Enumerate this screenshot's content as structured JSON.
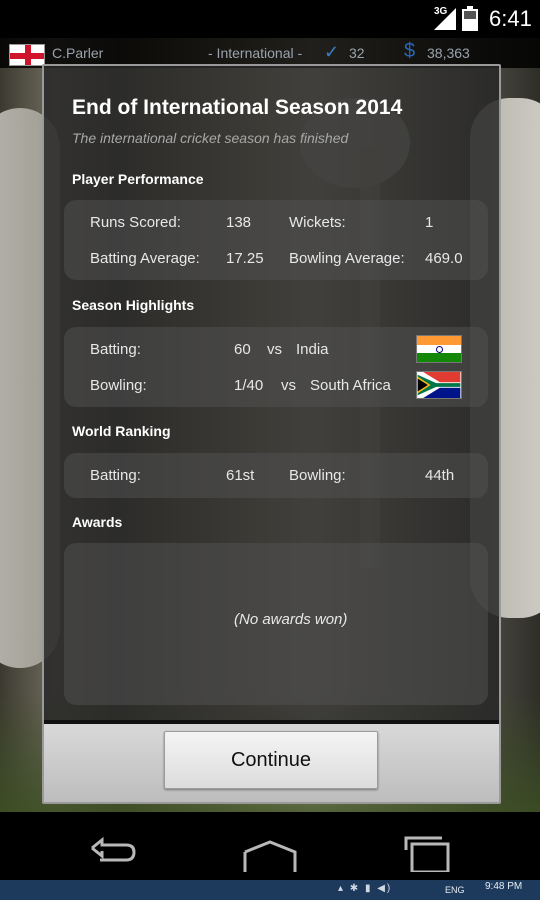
{
  "status_bar": {
    "network": "3G",
    "time": "6:41"
  },
  "top_info": {
    "player_name": "C.Parler",
    "mode": "- International -",
    "wickets_count": "32",
    "money": "38,363"
  },
  "dialog": {
    "title": "End of International Season 2014",
    "subtitle": "The international cricket season has finished",
    "player_performance": {
      "heading": "Player Performance",
      "runs_label": "Runs Scored:",
      "runs_value": "138",
      "wickets_label": "Wickets:",
      "wickets_value": "1",
      "bat_avg_label": "Batting Average:",
      "bat_avg_value": "17.25",
      "bowl_avg_label": "Bowling Average:",
      "bowl_avg_value": "469.0"
    },
    "season_highlights": {
      "heading": "Season Highlights",
      "batting_label": "Batting:",
      "batting_value": "60",
      "batting_vs": "vs",
      "batting_opponent": "India",
      "bowling_label": "Bowling:",
      "bowling_value": "1/40",
      "bowling_vs": "vs",
      "bowling_opponent": "South Africa"
    },
    "world_ranking": {
      "heading": "World Ranking",
      "batting_label": "Batting:",
      "batting_value": "61st",
      "bowling_label": "Bowling:",
      "bowling_value": "44th"
    },
    "awards": {
      "heading": "Awards",
      "empty_text": "(No awards won)"
    },
    "continue_label": "Continue"
  },
  "taskbar": {
    "lang": "ENG",
    "time": "9:48 PM"
  },
  "colors": {
    "dialog_bg": "#282828",
    "panel_bg": "#505050",
    "accent_blue": "#2a67b5"
  }
}
